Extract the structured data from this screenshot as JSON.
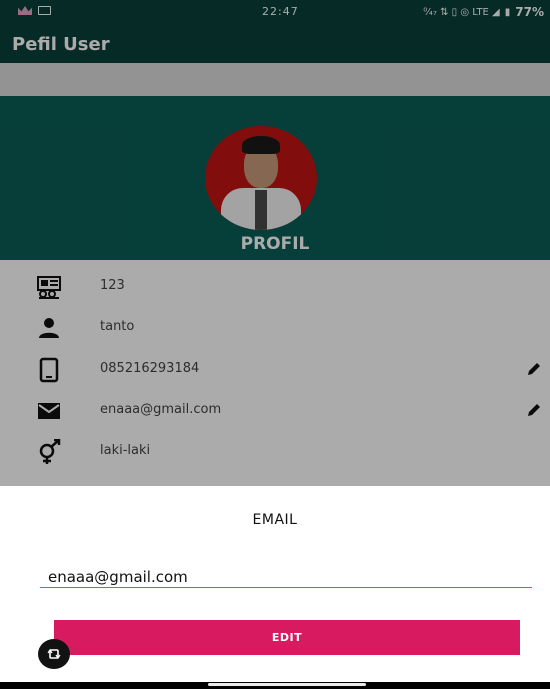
{
  "status_bar": {
    "time": "22:47",
    "right_indicators": "⁰⁄₄₇ ⇅ ▯ ◎ LTE ◢",
    "battery": "77%"
  },
  "app_bar": {
    "title": "Pefil User"
  },
  "profile": {
    "label": "PROFIL"
  },
  "info": {
    "items": [
      {
        "icon": "id-card-icon",
        "text": "123"
      },
      {
        "icon": "person-icon",
        "text": "tanto"
      },
      {
        "icon": "phone-icon",
        "text": "085216293184",
        "editable": true
      },
      {
        "icon": "mail-icon",
        "text": "enaaa@gmail.com",
        "editable": true
      },
      {
        "icon": "gender-icon",
        "text": "laki-laki"
      }
    ]
  },
  "dialog": {
    "title": "EMAIL",
    "input_value": "enaaa@gmail.com",
    "button_label": "EDIT"
  },
  "colors": {
    "primary_dark": "#0a3f3a",
    "header": "#0a5d55",
    "accent": "#d81b60",
    "input_underline": "#1aa39a"
  }
}
